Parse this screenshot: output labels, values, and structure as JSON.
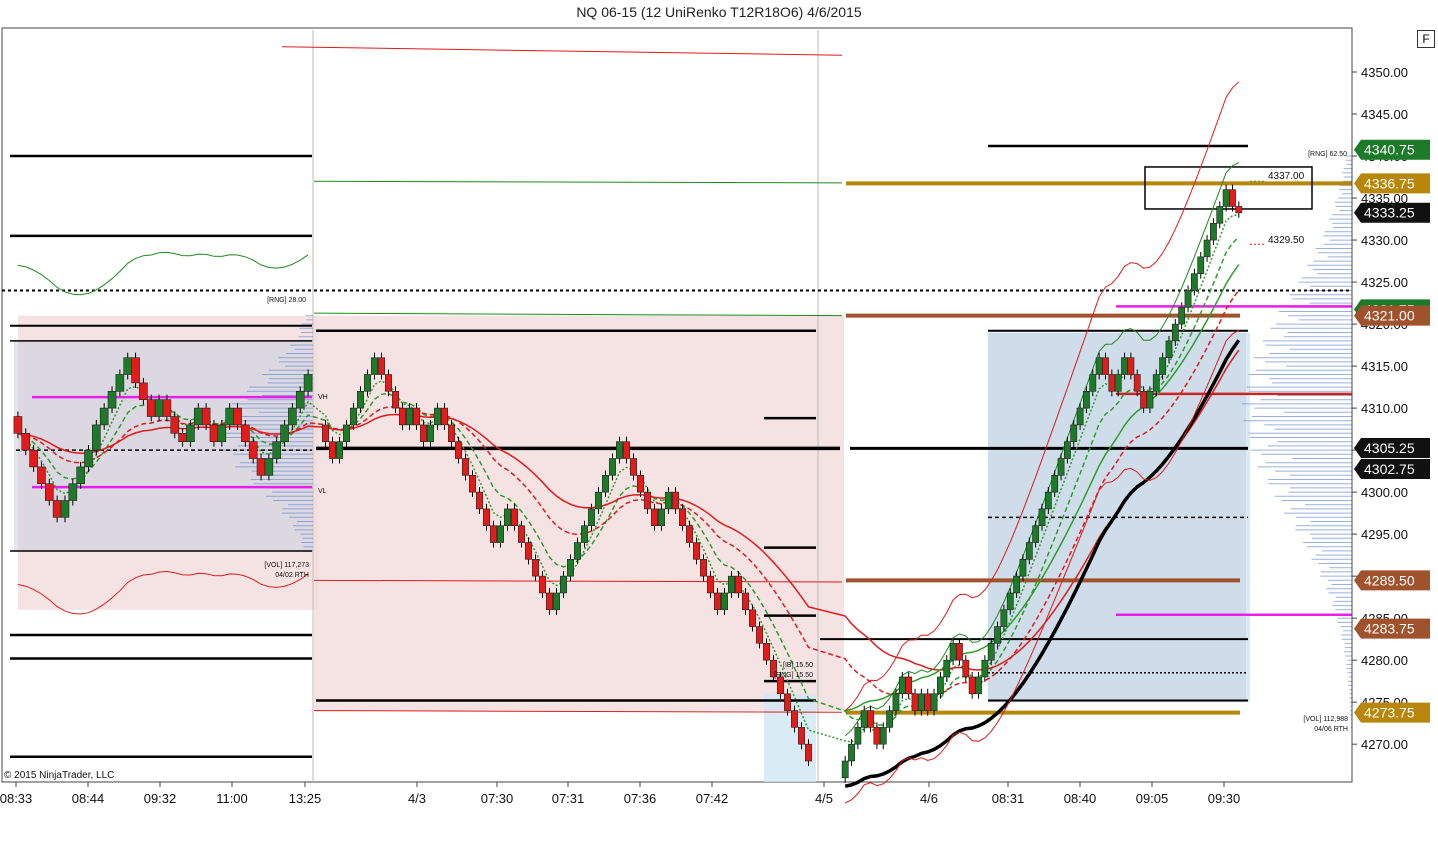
{
  "window": {
    "title": "NQ 06-15 (12 UniRenko T12R18O6)  4/6/2015",
    "f_button": "F"
  },
  "copyright": "© 2015 NinjaTrader, LLC",
  "colors": {
    "up_candle": "#1c7a28",
    "down_candle": "#e21b1b",
    "va_pink": "#f3dcdc",
    "va_blue": "#cfe6f2",
    "profile_blue": "#6f8fcf",
    "gold_level": "#b8860b",
    "brown_level": "#a0522d",
    "magenta_level": "#e81fe8",
    "green_band": "#1e8a1e",
    "red_band": "#e01b1b"
  },
  "chart_data": {
    "type": "candlestick",
    "instrument": "NQ 06-15",
    "bar_type": "12 UniRenko T12R18O6",
    "date": "4/6/2015",
    "y_axis": {
      "min": 4265.5,
      "max": 4355.0,
      "ticks": [
        4270,
        4275,
        4280,
        4285,
        4290,
        4295,
        4300,
        4305,
        4310,
        4315,
        4320,
        4325,
        4330,
        4335,
        4340,
        4345,
        4350
      ],
      "tick_labels": [
        "4270.00",
        "4275.00",
        "4280.00",
        "4285.00",
        "4290.00",
        "4295.00",
        "4300.00",
        "4305.00",
        "4310.00",
        "4315.00",
        "4320.00",
        "4325.00",
        "4330.00",
        "4335.00",
        "4340.00",
        "4345.00",
        "4350.00"
      ]
    },
    "x_axis": {
      "tick_labels": [
        "08:33",
        "08:44",
        "09:32",
        "11:00",
        "13:25",
        "4/3",
        "07:30",
        "07:31",
        "07:36",
        "07:42",
        "4/5",
        "4/6",
        "08:31",
        "08:40",
        "09:05",
        "09:30"
      ]
    },
    "price_tags": [
      {
        "value": 4340.75,
        "label": "4340.75",
        "color": "#1c7a28"
      },
      {
        "value": 4336.75,
        "label": "4336.75",
        "color": "#b8860b"
      },
      {
        "value": 4333.25,
        "label": "4333.25",
        "color": "#111111"
      },
      {
        "value": 4321.75,
        "label": "4321.75",
        "color": "#1c7a28"
      },
      {
        "value": 4321.0,
        "label": "4321.00",
        "color": "#a0522d"
      },
      {
        "value": 4305.25,
        "label": "4305.25",
        "color": "#111111"
      },
      {
        "value": 4302.75,
        "label": "4302.75",
        "color": "#111111"
      },
      {
        "value": 4289.5,
        "label": "4289.50",
        "color": "#a0522d"
      },
      {
        "value": 4283.75,
        "label": "4283.75",
        "color": "#a0522d"
      },
      {
        "value": 4273.75,
        "label": "4273.75",
        "color": "#b8860b"
      }
    ],
    "annotations": [
      {
        "text": "[RNG] 28.00",
        "session": 0
      },
      {
        "text": "[VOL] 117,273",
        "session": 0
      },
      {
        "text": "04/02 RTH",
        "session": 0
      },
      {
        "text": "VH",
        "session": 0
      },
      {
        "text": "VL",
        "session": 0
      },
      {
        "text": "[IB] 15.50",
        "session": 1
      },
      {
        "text": "[RNG] 15.50",
        "session": 1
      },
      {
        "text": "[RNG] 62.50",
        "session": 2
      },
      {
        "text": "[VOL] 112,988",
        "session": 2
      },
      {
        "text": "04/06 RTH",
        "session": 2
      },
      {
        "text": "4337.00",
        "session": 2
      },
      {
        "text": "4329.50",
        "session": 2
      }
    ],
    "sessions": [
      {
        "name": "04/02 RTH",
        "closes": [
          4307,
          4305,
          4303,
          4301,
          4299,
          4297,
          4299,
          4301,
          4303,
          4305,
          4308,
          4310,
          4312,
          4314,
          4316,
          4313,
          4311,
          4309,
          4311,
          4309,
          4307,
          4306,
          4308,
          4310,
          4308,
          4306,
          4308,
          4310,
          4308,
          4306,
          4304,
          4302,
          4304,
          4306,
          4308,
          4310,
          4312,
          4314
        ],
        "high": 4321,
        "low": 4293,
        "va_high": 4318,
        "va_low": 4293
      },
      {
        "name": "4/3",
        "closes": [
          4306,
          4304,
          4306,
          4308,
          4310,
          4312,
          4314,
          4316,
          4314,
          4312,
          4310,
          4308,
          4310,
          4308,
          4306,
          4308,
          4310,
          4308,
          4306,
          4304,
          4302,
          4300,
          4298,
          4296,
          4294,
          4296,
          4298,
          4296,
          4294,
          4292,
          4290,
          4288,
          4286,
          4288,
          4290,
          4292,
          4294,
          4296,
          4298,
          4300,
          4302,
          4304,
          4306,
          4304,
          4302,
          4300,
          4298,
          4296,
          4298,
          4300,
          4298,
          4296,
          4294,
          4292,
          4290,
          4288,
          4286,
          4288,
          4290,
          4288,
          4286,
          4284,
          4282,
          4280,
          4278,
          4276,
          4274,
          4272,
          4270,
          4268
        ],
        "high": 4319,
        "low": 4266
      },
      {
        "name": "04/06 RTH",
        "closes": [
          4268,
          4270,
          4272,
          4274,
          4272,
          4270,
          4272,
          4274,
          4276,
          4278,
          4276,
          4274,
          4276,
          4274,
          4276,
          4278,
          4280,
          4282,
          4280,
          4278,
          4276,
          4278,
          4280,
          4282,
          4284,
          4286,
          4288,
          4290,
          4292,
          4294,
          4296,
          4298,
          4300,
          4302,
          4304,
          4306,
          4308,
          4310,
          4312,
          4314,
          4316,
          4314,
          4312,
          4314,
          4316,
          4314,
          4312,
          4310,
          4312,
          4314,
          4316,
          4318,
          4320,
          4322,
          4324,
          4326,
          4328,
          4330,
          4332,
          4334,
          4336,
          4334,
          4333.25
        ],
        "high": 4336.75,
        "low": 4266,
        "va_high": 4319,
        "va_low": 4275
      }
    ]
  }
}
